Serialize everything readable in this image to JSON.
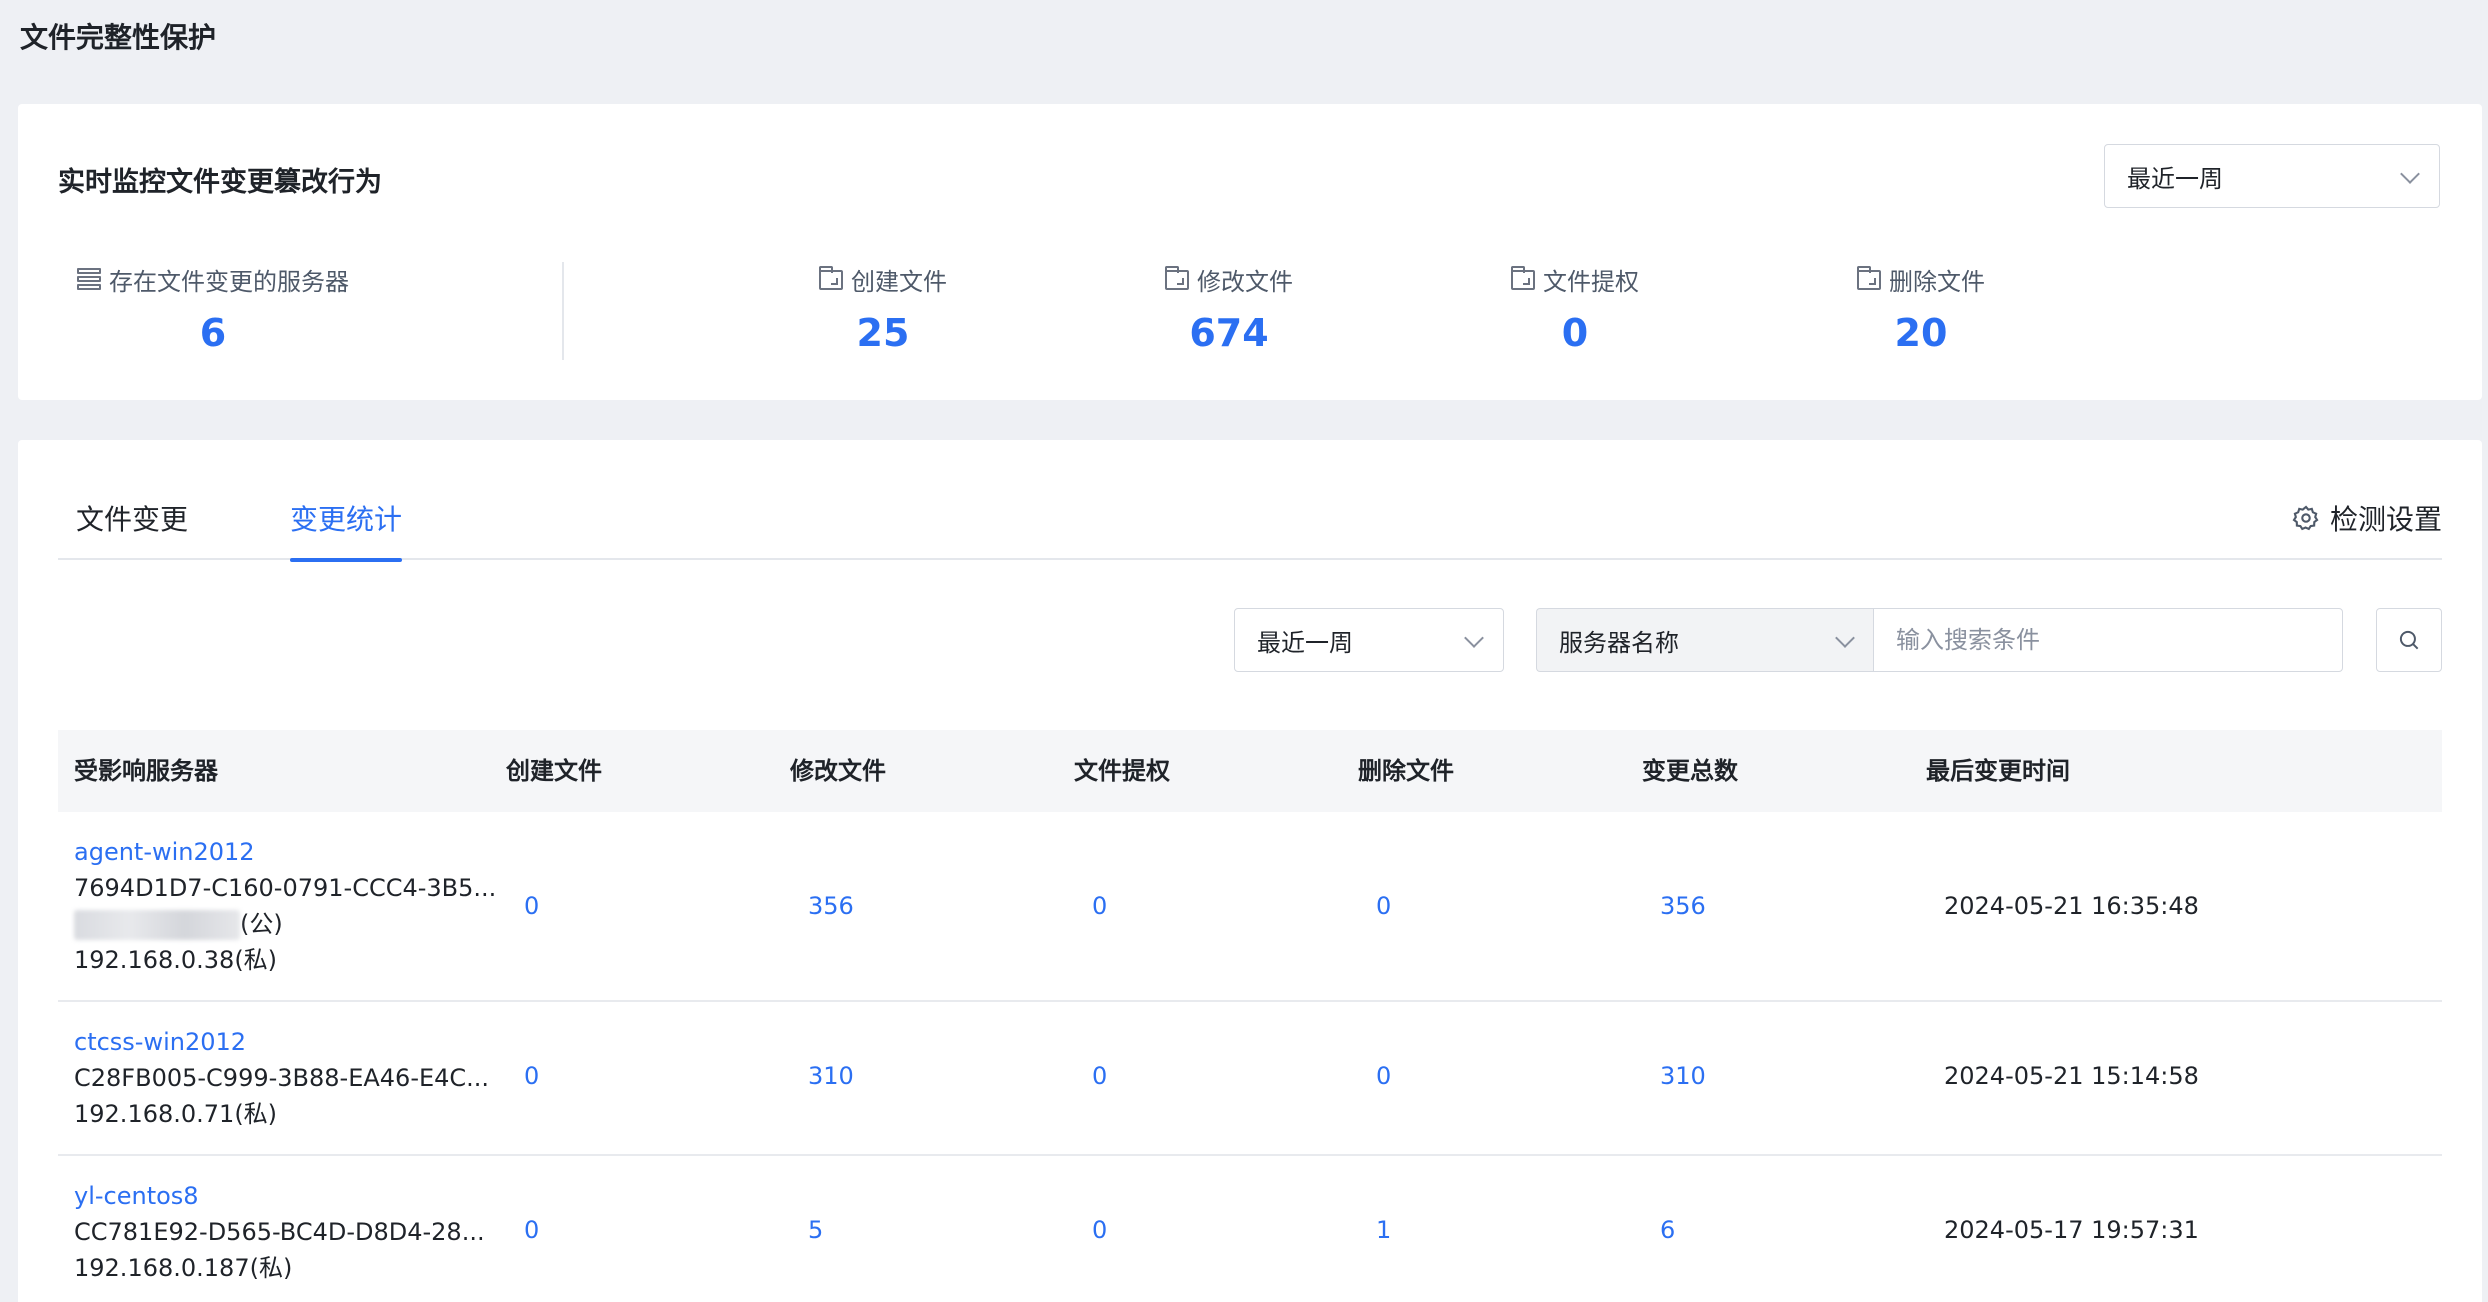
{
  "page": {
    "title": "文件完整性保护"
  },
  "summary": {
    "title": "实时监控文件变更篡改行为",
    "period": "最近一周",
    "stats": [
      {
        "label": "存在文件变更的服务器",
        "value": "6",
        "icon": "server-icon"
      },
      {
        "label": "创建文件",
        "value": "25",
        "icon": "folder-icon"
      },
      {
        "label": "修改文件",
        "value": "674",
        "icon": "folder-icon"
      },
      {
        "label": "文件提权",
        "value": "0",
        "icon": "folder-icon"
      },
      {
        "label": "删除文件",
        "value": "20",
        "icon": "folder-icon"
      }
    ]
  },
  "tabs": [
    {
      "label": "文件变更",
      "active": false
    },
    {
      "label": "变更统计",
      "active": true
    }
  ],
  "settings_label": "检测设置",
  "filters": {
    "period": "最近一周",
    "field": "服务器名称",
    "search_placeholder": "输入搜索条件"
  },
  "table": {
    "columns": [
      "受影响服务器",
      "创建文件",
      "修改文件",
      "文件提权",
      "删除文件",
      "变更总数",
      "最后变更时间"
    ],
    "rows": [
      {
        "name": "agent-win2012",
        "id": "7694D1D7-C160-0791-CCC4-3B5...",
        "public_ip_suffix": "(公)",
        "ip": "192.168.0.38(私)",
        "create": "0",
        "modify": "356",
        "escalate": "0",
        "delete": "0",
        "total": "356",
        "last_time": "2024-05-21 16:35:48"
      },
      {
        "name": "ctcss-win2012",
        "id": "C28FB005-C999-3B88-EA46-E4C...",
        "ip": "192.168.0.71(私)",
        "create": "0",
        "modify": "310",
        "escalate": "0",
        "delete": "0",
        "total": "310",
        "last_time": "2024-05-21 15:14:58"
      },
      {
        "name": "yl-centos8",
        "id": "CC781E92-D565-BC4D-D8D4-28...",
        "ip": "192.168.0.187(私)",
        "create": "0",
        "modify": "5",
        "escalate": "0",
        "delete": "1",
        "total": "6",
        "last_time": "2024-05-17 19:57:31"
      }
    ]
  },
  "colors": {
    "accent": "#2b6ff2",
    "background": "#eef0f4"
  }
}
